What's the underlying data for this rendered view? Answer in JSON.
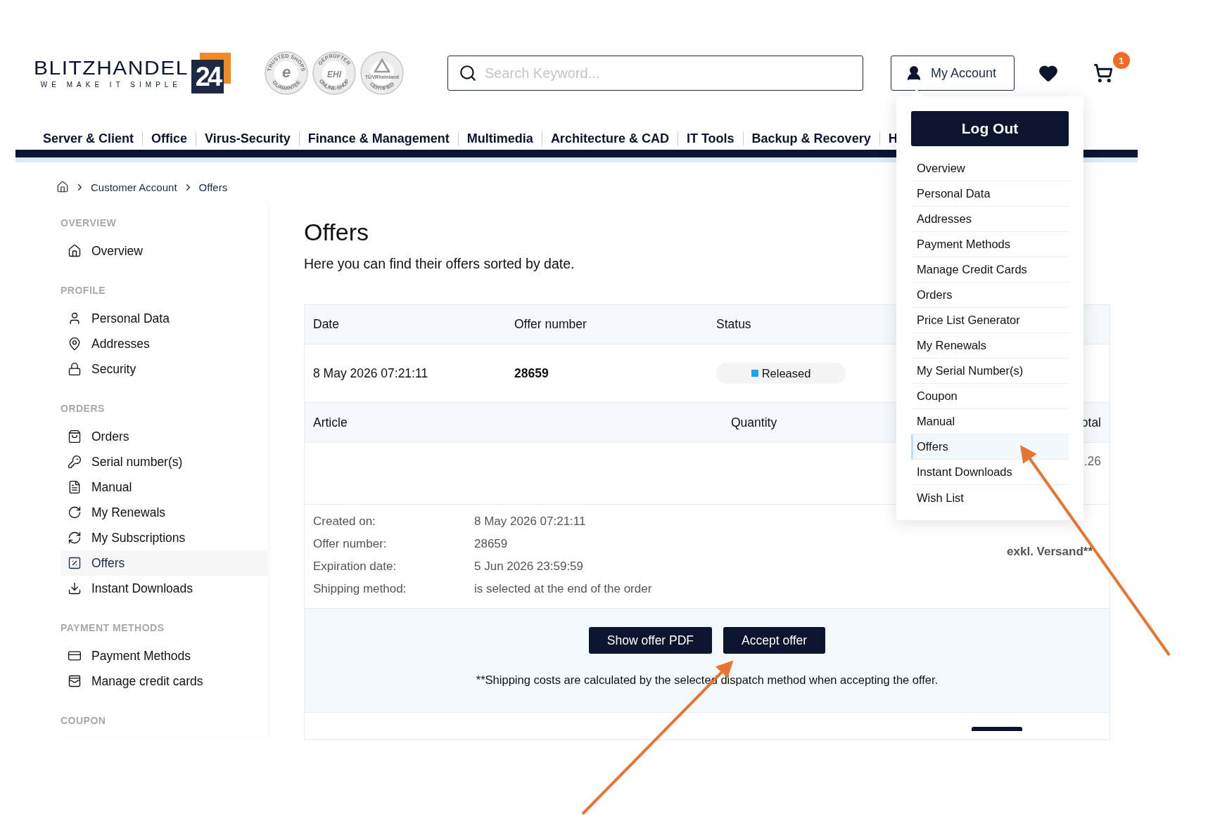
{
  "logo": {
    "wordmark": "BLITZHANDEL",
    "tagline": "WE MAKE IT SIMPLE",
    "number": "24"
  },
  "trust_badges": [
    {
      "kind": "letter",
      "center": "e",
      "ring_top": "TRUSTED SHOPS",
      "ring_bottom": "GUARANTEE"
    },
    {
      "kind": "letter",
      "center": "EHI",
      "ring_top": "GEPRÜFTER",
      "ring_bottom": "ONLINE-SHOP"
    },
    {
      "kind": "triangle",
      "center": "TÜVRheinland",
      "ring_bottom": "CERTIFIED"
    }
  ],
  "search": {
    "placeholder": "Search Keyword..."
  },
  "account_button": "My Account",
  "cart": {
    "count": "1"
  },
  "nav": [
    "Server & Client",
    "Office",
    "Virus-Security",
    "Finance & Management",
    "Multimedia",
    "Architecture & CAD",
    "IT Tools",
    "Backup & Recovery",
    "H"
  ],
  "breadcrumb": [
    "Customer Account",
    "Offers"
  ],
  "sidebar": [
    {
      "heading": "OVERVIEW",
      "items": [
        {
          "label": "Overview",
          "selected": false
        }
      ]
    },
    {
      "heading": "PROFILE",
      "items": [
        {
          "label": "Personal Data",
          "selected": false
        },
        {
          "label": "Addresses",
          "selected": false
        },
        {
          "label": "Security",
          "selected": false
        }
      ]
    },
    {
      "heading": "ORDERS",
      "items": [
        {
          "label": "Orders",
          "selected": false
        },
        {
          "label": "Serial number(s)",
          "selected": false
        },
        {
          "label": "Manual",
          "selected": false
        },
        {
          "label": "My Renewals",
          "selected": false
        },
        {
          "label": "My Subscriptions",
          "selected": false
        },
        {
          "label": "Offers",
          "selected": true
        },
        {
          "label": "Instant Downloads",
          "selected": false
        }
      ]
    },
    {
      "heading": "PAYMENT METHODS",
      "items": [
        {
          "label": "Payment Methods",
          "selected": false
        },
        {
          "label": "Manage credit cards",
          "selected": false
        }
      ]
    },
    {
      "heading": "COUPON"
    }
  ],
  "page": {
    "title": "Offers",
    "subtitle": "Here you can find their offers sorted by date."
  },
  "offer_table": {
    "columns": [
      "Date",
      "Offer number",
      "Status"
    ],
    "row": {
      "date": "8 May 2026 07:21:11",
      "number": "28659",
      "status": "Released"
    },
    "article_columns": [
      "Article",
      "Quantity",
      "otal"
    ],
    "article_row": {
      "column_3": ".26"
    },
    "details": [
      {
        "label": "Created on:",
        "value": "8 May 2026 07:21:11"
      },
      {
        "label": "Offer number:",
        "value": "28659"
      },
      {
        "label": "Expiration date:",
        "value": "5 Jun 2026 23:59:59"
      },
      {
        "label": "Shipping method:",
        "value": "is selected at the end of the order"
      }
    ],
    "shipping_note": "exkl. Versand**",
    "buttons": [
      "Show offer PDF",
      "Accept offer"
    ],
    "footnote": "**Shipping costs are calculated by the selected dispatch method when accepting the offer."
  },
  "account_menu": {
    "logout": "Log Out",
    "items": [
      {
        "label": "Overview",
        "selected": false
      },
      {
        "label": "Personal Data",
        "selected": false
      },
      {
        "label": "Addresses",
        "selected": false
      },
      {
        "label": "Payment Methods",
        "selected": false
      },
      {
        "label": "Manage Credit Cards",
        "selected": false
      },
      {
        "label": "Orders",
        "selected": false
      },
      {
        "label": "Price List Generator",
        "selected": false
      },
      {
        "label": "My Renewals",
        "selected": false
      },
      {
        "label": "My Serial Number(s)",
        "selected": false
      },
      {
        "label": "Coupon",
        "selected": false
      },
      {
        "label": "Manual",
        "selected": false
      },
      {
        "label": "Offers",
        "selected": true
      },
      {
        "label": "Instant Downloads",
        "selected": false
      },
      {
        "label": "Wish List",
        "selected": false
      }
    ]
  }
}
